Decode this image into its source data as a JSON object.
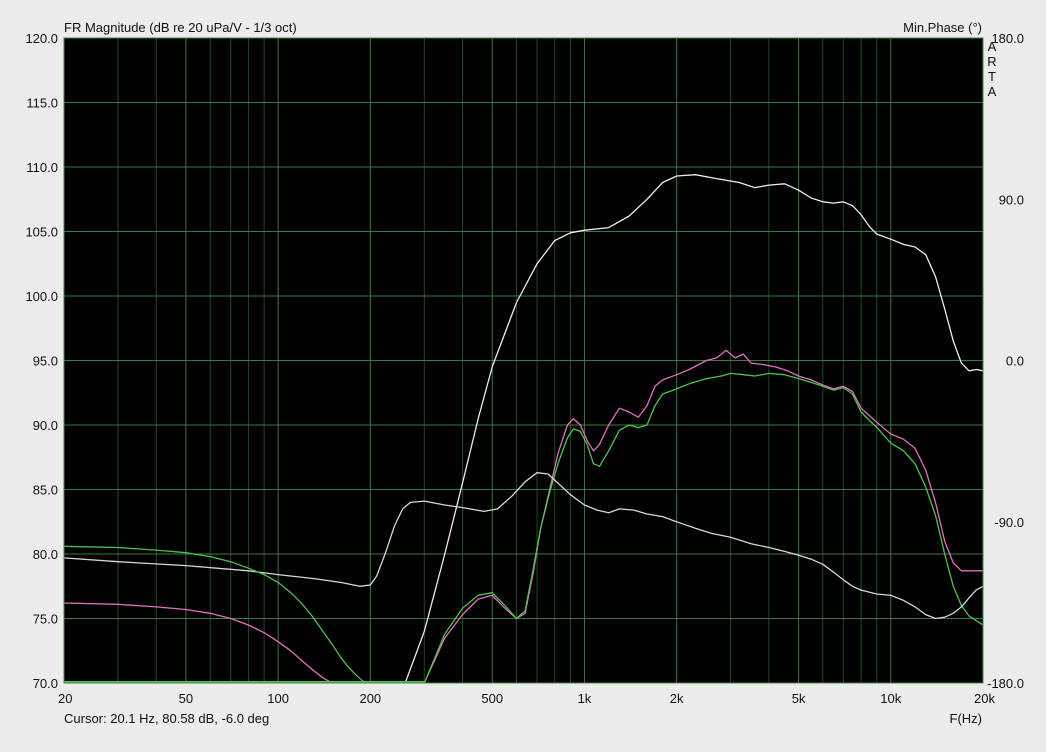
{
  "chart_data": {
    "type": "line",
    "title": "FR Magnitude (dB re 20 uPa/V - 1/3 oct)",
    "right_axis_title": "Min.Phase (°)",
    "watermark": "ARTA",
    "xlabel": "F(Hz)",
    "x_scale": "log",
    "xlim": [
      20,
      20000
    ],
    "ylim": [
      70,
      120
    ],
    "y2lim": [
      -180,
      180
    ],
    "grid": true,
    "x_ticks": [
      {
        "value": 20,
        "label": "20"
      },
      {
        "value": 50,
        "label": "50"
      },
      {
        "value": 100,
        "label": "100"
      },
      {
        "value": 200,
        "label": "200"
      },
      {
        "value": 500,
        "label": "500"
      },
      {
        "value": 1000,
        "label": "1k"
      },
      {
        "value": 2000,
        "label": "2k"
      },
      {
        "value": 5000,
        "label": "5k"
      },
      {
        "value": 10000,
        "label": "10k"
      },
      {
        "value": 20000,
        "label": "20k"
      }
    ],
    "y_ticks": [
      {
        "value": 120,
        "label": "120.0"
      },
      {
        "value": 115,
        "label": "115.0"
      },
      {
        "value": 110,
        "label": "110.0"
      },
      {
        "value": 105,
        "label": "105.0"
      },
      {
        "value": 100,
        "label": "100.0"
      },
      {
        "value": 95,
        "label": "95.0"
      },
      {
        "value": 90,
        "label": "90.0"
      },
      {
        "value": 85,
        "label": "85.0"
      },
      {
        "value": 80,
        "label": "80.0"
      },
      {
        "value": 75,
        "label": "75.0"
      },
      {
        "value": 70,
        "label": "70.0"
      }
    ],
    "y2_ticks": [
      {
        "value": 180,
        "label": "180.0"
      },
      {
        "value": 90,
        "label": "90.0"
      },
      {
        "value": 0,
        "label": "0.0"
      },
      {
        "value": -90,
        "label": "-90.0"
      },
      {
        "value": -180,
        "label": "-180.0"
      }
    ],
    "series": [
      {
        "axis": "left",
        "color": "#ececec",
        "points": [
          [
            260,
            70
          ],
          [
            300,
            74
          ],
          [
            350,
            80
          ],
          [
            400,
            85.5
          ],
          [
            450,
            90.5
          ],
          [
            500,
            94.5
          ],
          [
            600,
            99.5
          ],
          [
            700,
            102.5
          ],
          [
            800,
            104.3
          ],
          [
            900,
            104.9
          ],
          [
            1000,
            105.1
          ],
          [
            1200,
            105.3
          ],
          [
            1400,
            106.2
          ],
          [
            1600,
            107.5
          ],
          [
            1800,
            108.8
          ],
          [
            2000,
            109.3
          ],
          [
            2300,
            109.4
          ],
          [
            2700,
            109.1
          ],
          [
            3200,
            108.8
          ],
          [
            3600,
            108.4
          ],
          [
            4000,
            108.6
          ],
          [
            4500,
            108.7
          ],
          [
            5000,
            108.2
          ],
          [
            5500,
            107.6
          ],
          [
            6000,
            107.3
          ],
          [
            6500,
            107.2
          ],
          [
            7000,
            107.3
          ],
          [
            7500,
            107.0
          ],
          [
            8000,
            106.3
          ],
          [
            8500,
            105.4
          ],
          [
            9000,
            104.8
          ],
          [
            10000,
            104.4
          ],
          [
            11000,
            104.0
          ],
          [
            12000,
            103.8
          ],
          [
            13000,
            103.2
          ],
          [
            14000,
            101.5
          ],
          [
            15000,
            99.0
          ],
          [
            16000,
            96.5
          ],
          [
            17000,
            94.8
          ],
          [
            18000,
            94.2
          ],
          [
            19000,
            94.3
          ],
          [
            20000,
            94.2
          ]
        ]
      },
      {
        "axis": "left",
        "color": "#e070c0",
        "points": [
          [
            300,
            70
          ],
          [
            350,
            73.5
          ],
          [
            400,
            75.3
          ],
          [
            450,
            76.5
          ],
          [
            500,
            76.8
          ],
          [
            550,
            75.8
          ],
          [
            600,
            75.0
          ],
          [
            640,
            75.4
          ],
          [
            680,
            78.5
          ],
          [
            720,
            82.0
          ],
          [
            770,
            85.0
          ],
          [
            820,
            87.8
          ],
          [
            880,
            90.0
          ],
          [
            920,
            90.5
          ],
          [
            970,
            90.0
          ],
          [
            1020,
            88.8
          ],
          [
            1070,
            88.0
          ],
          [
            1120,
            88.5
          ],
          [
            1200,
            90.0
          ],
          [
            1300,
            91.3
          ],
          [
            1400,
            91.0
          ],
          [
            1500,
            90.6
          ],
          [
            1600,
            91.5
          ],
          [
            1700,
            93.0
          ],
          [
            1800,
            93.5
          ],
          [
            2000,
            93.9
          ],
          [
            2200,
            94.3
          ],
          [
            2500,
            95.0
          ],
          [
            2700,
            95.2
          ],
          [
            2900,
            95.8
          ],
          [
            3100,
            95.2
          ],
          [
            3300,
            95.5
          ],
          [
            3500,
            94.8
          ],
          [
            3800,
            94.7
          ],
          [
            4200,
            94.5
          ],
          [
            4600,
            94.2
          ],
          [
            5000,
            93.8
          ],
          [
            5500,
            93.5
          ],
          [
            6000,
            93.1
          ],
          [
            6500,
            92.8
          ],
          [
            7000,
            93.0
          ],
          [
            7500,
            92.6
          ],
          [
            8000,
            91.3
          ],
          [
            9000,
            90.2
          ],
          [
            10000,
            89.3
          ],
          [
            11000,
            88.9
          ],
          [
            12000,
            88.2
          ],
          [
            13000,
            86.5
          ],
          [
            14000,
            84.0
          ],
          [
            15000,
            81.0
          ],
          [
            16000,
            79.3
          ],
          [
            17000,
            78.7
          ],
          [
            20000,
            78.7
          ]
        ]
      },
      {
        "axis": "left",
        "color": "#4cc44c",
        "points": [
          [
            300,
            70
          ],
          [
            350,
            73.8
          ],
          [
            400,
            75.8
          ],
          [
            450,
            76.8
          ],
          [
            500,
            77.0
          ],
          [
            550,
            76.0
          ],
          [
            600,
            75.0
          ],
          [
            640,
            75.6
          ],
          [
            680,
            78.8
          ],
          [
            720,
            82.0
          ],
          [
            770,
            84.8
          ],
          [
            820,
            87.0
          ],
          [
            880,
            89.0
          ],
          [
            920,
            89.7
          ],
          [
            970,
            89.5
          ],
          [
            1020,
            88.5
          ],
          [
            1070,
            87.0
          ],
          [
            1120,
            86.8
          ],
          [
            1200,
            88.0
          ],
          [
            1300,
            89.6
          ],
          [
            1400,
            90.0
          ],
          [
            1500,
            89.8
          ],
          [
            1600,
            90.0
          ],
          [
            1700,
            91.5
          ],
          [
            1800,
            92.4
          ],
          [
            2000,
            92.8
          ],
          [
            2200,
            93.2
          ],
          [
            2500,
            93.6
          ],
          [
            2800,
            93.8
          ],
          [
            3000,
            94.0
          ],
          [
            3300,
            93.9
          ],
          [
            3600,
            93.8
          ],
          [
            4000,
            94.0
          ],
          [
            4500,
            93.9
          ],
          [
            5000,
            93.6
          ],
          [
            5500,
            93.3
          ],
          [
            6000,
            93.0
          ],
          [
            6500,
            92.7
          ],
          [
            7000,
            92.9
          ],
          [
            7500,
            92.4
          ],
          [
            8000,
            91.0
          ],
          [
            9000,
            89.8
          ],
          [
            10000,
            88.6
          ],
          [
            11000,
            88.0
          ],
          [
            12000,
            87.0
          ],
          [
            13000,
            85.2
          ],
          [
            14000,
            83.0
          ],
          [
            15000,
            80.0
          ],
          [
            16000,
            77.5
          ],
          [
            17000,
            76.0
          ],
          [
            18000,
            75.2
          ],
          [
            20000,
            74.5
          ]
        ]
      },
      {
        "axis": "left",
        "color": "#d8d8d8",
        "points": [
          [
            20,
            79.7
          ],
          [
            30,
            79.4
          ],
          [
            50,
            79.1
          ],
          [
            80,
            78.7
          ],
          [
            100,
            78.4
          ],
          [
            130,
            78.1
          ],
          [
            160,
            77.8
          ],
          [
            185,
            77.5
          ],
          [
            200,
            77.6
          ],
          [
            210,
            78.3
          ],
          [
            225,
            80.2
          ],
          [
            240,
            82.2
          ],
          [
            255,
            83.5
          ],
          [
            270,
            84.0
          ],
          [
            300,
            84.1
          ],
          [
            350,
            83.8
          ],
          [
            400,
            83.6
          ],
          [
            470,
            83.3
          ],
          [
            520,
            83.5
          ],
          [
            580,
            84.5
          ],
          [
            640,
            85.6
          ],
          [
            700,
            86.3
          ],
          [
            760,
            86.2
          ],
          [
            820,
            85.5
          ],
          [
            900,
            84.6
          ],
          [
            1000,
            83.8
          ],
          [
            1100,
            83.4
          ],
          [
            1200,
            83.2
          ],
          [
            1300,
            83.5
          ],
          [
            1450,
            83.4
          ],
          [
            1600,
            83.1
          ],
          [
            1800,
            82.9
          ],
          [
            2000,
            82.5
          ],
          [
            2300,
            82.0
          ],
          [
            2600,
            81.6
          ],
          [
            3000,
            81.3
          ],
          [
            3500,
            80.8
          ],
          [
            4000,
            80.5
          ],
          [
            4500,
            80.2
          ],
          [
            5000,
            79.9
          ],
          [
            5500,
            79.6
          ],
          [
            6000,
            79.2
          ],
          [
            6500,
            78.6
          ],
          [
            7000,
            78.0
          ],
          [
            7500,
            77.5
          ],
          [
            8000,
            77.2
          ],
          [
            9000,
            76.9
          ],
          [
            10000,
            76.8
          ],
          [
            11000,
            76.4
          ],
          [
            12000,
            75.9
          ],
          [
            13000,
            75.3
          ],
          [
            14000,
            75.0
          ],
          [
            15000,
            75.1
          ],
          [
            16000,
            75.4
          ],
          [
            17000,
            75.9
          ],
          [
            18000,
            76.6
          ],
          [
            19000,
            77.2
          ],
          [
            20000,
            77.5
          ]
        ]
      },
      {
        "axis": "left",
        "color": "#4cc44c",
        "points": [
          [
            20,
            80.6
          ],
          [
            30,
            80.5
          ],
          [
            40,
            80.3
          ],
          [
            50,
            80.1
          ],
          [
            60,
            79.8
          ],
          [
            70,
            79.4
          ],
          [
            80,
            78.9
          ],
          [
            90,
            78.4
          ],
          [
            100,
            77.8
          ],
          [
            110,
            77.0
          ],
          [
            120,
            76.1
          ],
          [
            130,
            75.1
          ],
          [
            140,
            74.0
          ],
          [
            150,
            73.0
          ],
          [
            160,
            72.0
          ],
          [
            170,
            71.2
          ],
          [
            180,
            70.6
          ],
          [
            190,
            70.1
          ],
          [
            200,
            70.0
          ]
        ]
      },
      {
        "axis": "left",
        "color": "#e070c0",
        "points": [
          [
            20,
            76.2
          ],
          [
            30,
            76.1
          ],
          [
            40,
            75.9
          ],
          [
            50,
            75.7
          ],
          [
            60,
            75.4
          ],
          [
            70,
            75.0
          ],
          [
            80,
            74.5
          ],
          [
            90,
            73.9
          ],
          [
            100,
            73.2
          ],
          [
            110,
            72.5
          ],
          [
            120,
            71.7
          ],
          [
            130,
            71.0
          ],
          [
            140,
            70.4
          ],
          [
            150,
            70.0
          ]
        ]
      }
    ]
  },
  "status": {
    "cursor": "Cursor: 20.1 Hz, 80.58 dB, -6.0 deg"
  }
}
